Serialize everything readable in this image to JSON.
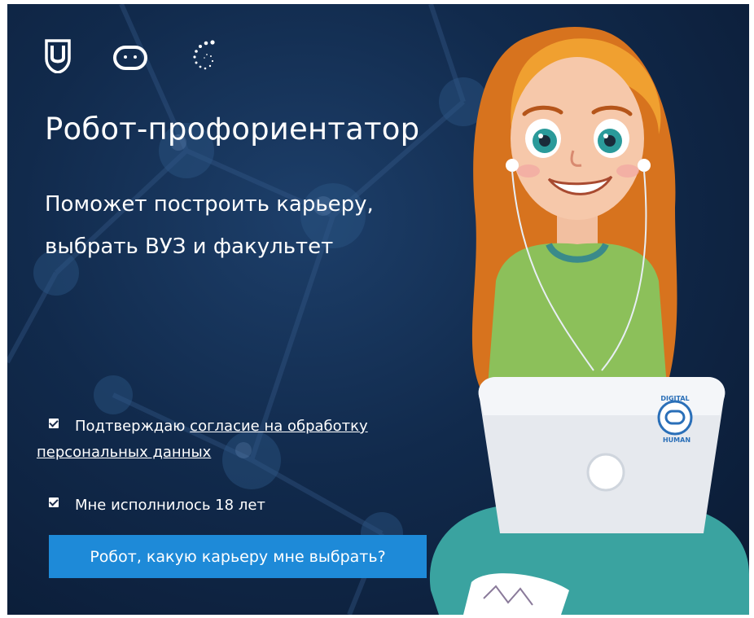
{
  "hero": {
    "title": "Робот-профориентатор",
    "subtitle_line1": "Поможет построить карьеру,",
    "subtitle_line2": "выбрать ВУЗ и факультет"
  },
  "logos": [
    "university-shield-icon",
    "digital-human-face-icon",
    "spiral-dots-icon"
  ],
  "consent": {
    "prefix": "Подтверждаю",
    "link_line1": "согласие на обработку",
    "link_line2": "персональных данных",
    "checked": true
  },
  "age_check": {
    "label": "Мне исполнилось 18 лет",
    "checked": true
  },
  "cta": {
    "label": "Робот, какую карьеру мне выбрать?"
  },
  "colors": {
    "background": "#112a4c",
    "button": "#1e8ad8",
    "text": "#ffffff"
  },
  "laptop_sticker": {
    "top_text": "DIGITAL",
    "bottom_text": "HUMAN"
  }
}
